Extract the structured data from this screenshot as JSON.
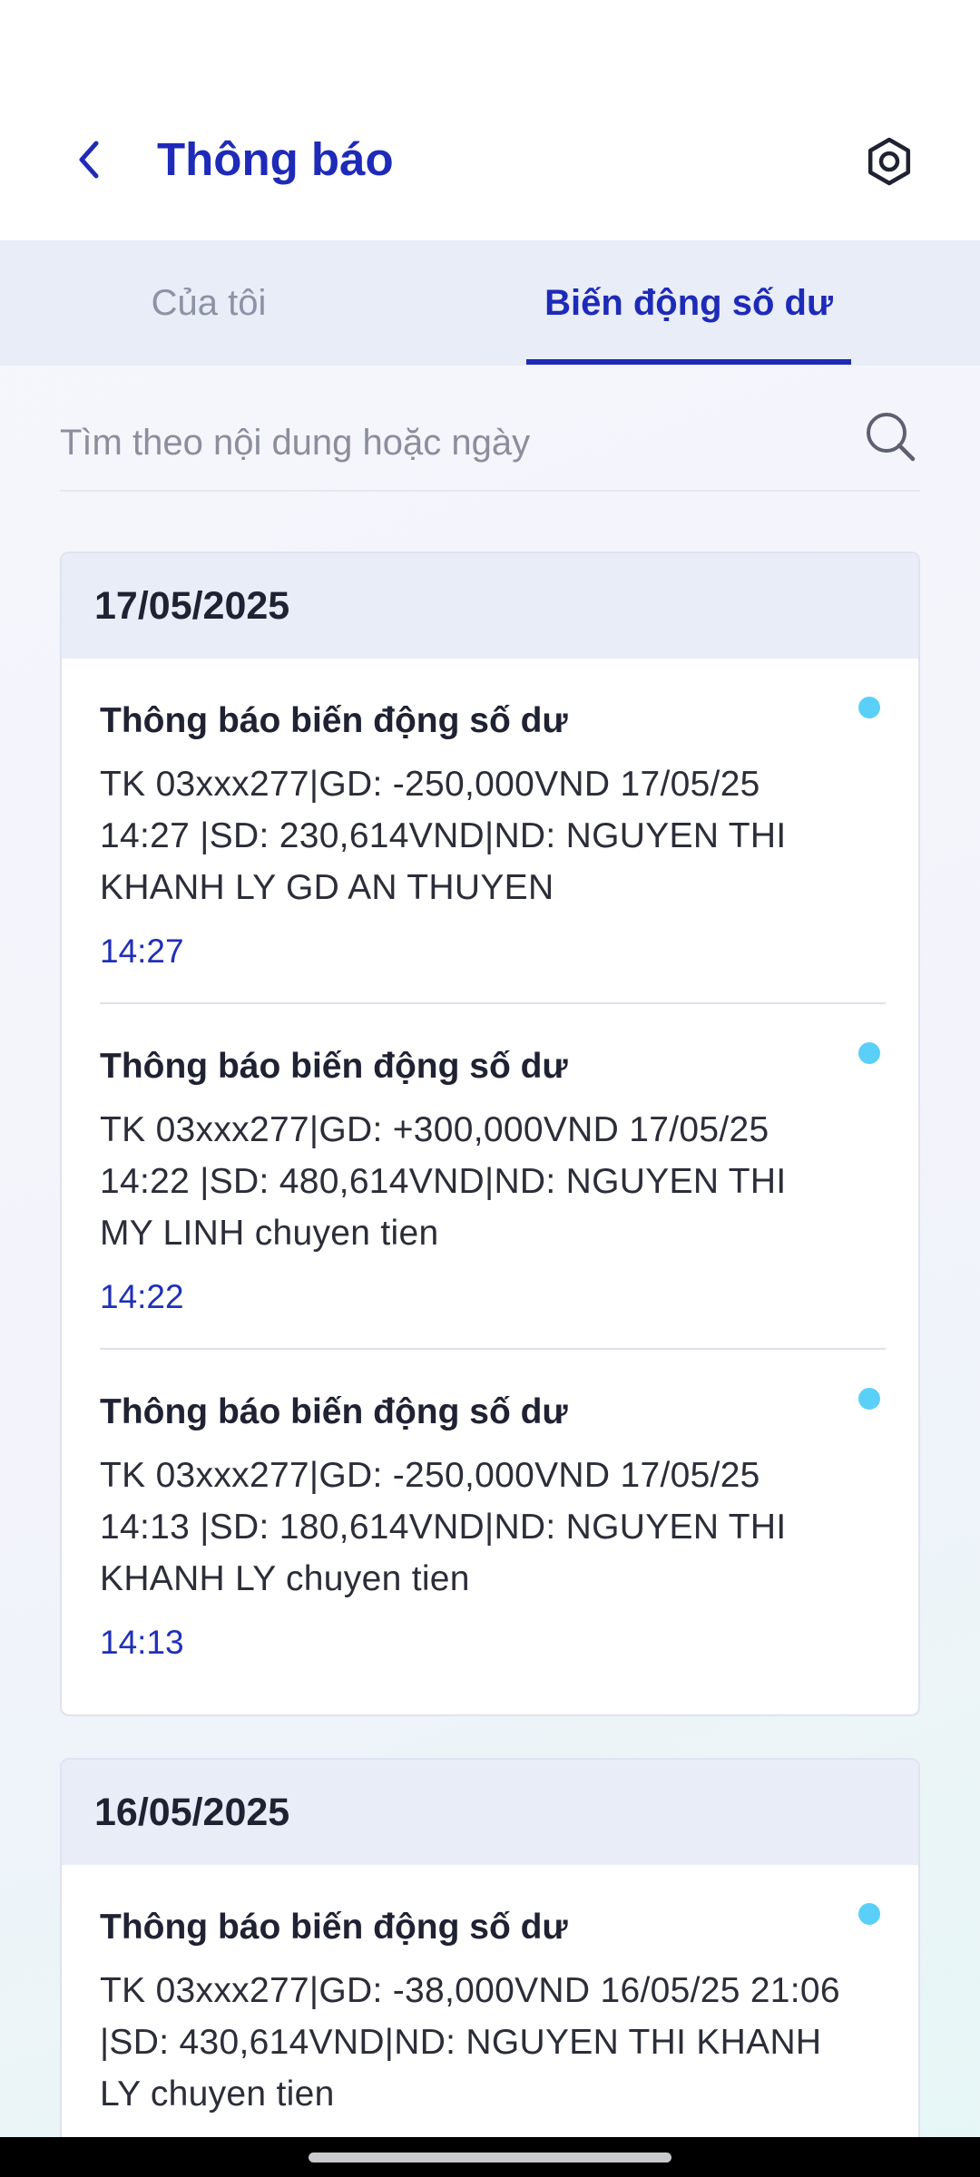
{
  "header": {
    "title": "Thông báo",
    "back_icon": "chevron-left-icon",
    "settings_icon": "gear-icon"
  },
  "tabs": [
    {
      "label": "Của tôi",
      "selected": false
    },
    {
      "label": "Biến động số dư",
      "selected": true
    }
  ],
  "search": {
    "placeholder": "Tìm theo nội dung hoặc ngày",
    "value": ""
  },
  "colors": {
    "accent": "#1e2ab8",
    "unread_dot": "#5ad0f8",
    "tab_bar_bg": "#e9edf7"
  },
  "groups": [
    {
      "date": "17/05/2025",
      "items": [
        {
          "title": "Thông báo biến động số dư",
          "body": "TK 03xxx277|GD: -250,000VND 17/05/25 14:27 |SD: 230,614VND|ND: NGUYEN THI KHANH LY GD AN THUYEN",
          "time": "14:27",
          "unread": true
        },
        {
          "title": "Thông báo biến động số dư",
          "body": "TK 03xxx277|GD: +300,000VND 17/05/25 14:22 |SD: 480,614VND|ND: NGUYEN THI MY LINH chuyen tien",
          "time": "14:22",
          "unread": true
        },
        {
          "title": "Thông báo biến động số dư",
          "body": "TK 03xxx277|GD: -250,000VND 17/05/25 14:13 |SD: 180,614VND|ND: NGUYEN THI KHANH LY chuyen tien",
          "time": "14:13",
          "unread": true
        }
      ]
    },
    {
      "date": "16/05/2025",
      "items": [
        {
          "title": "Thông báo biến động số dư",
          "body": "TK 03xxx277|GD: -38,000VND 16/05/25 21:06 |SD: 430,614VND|ND: NGUYEN THI KHANH LY chuyen tien",
          "time": "",
          "unread": true
        }
      ]
    }
  ]
}
